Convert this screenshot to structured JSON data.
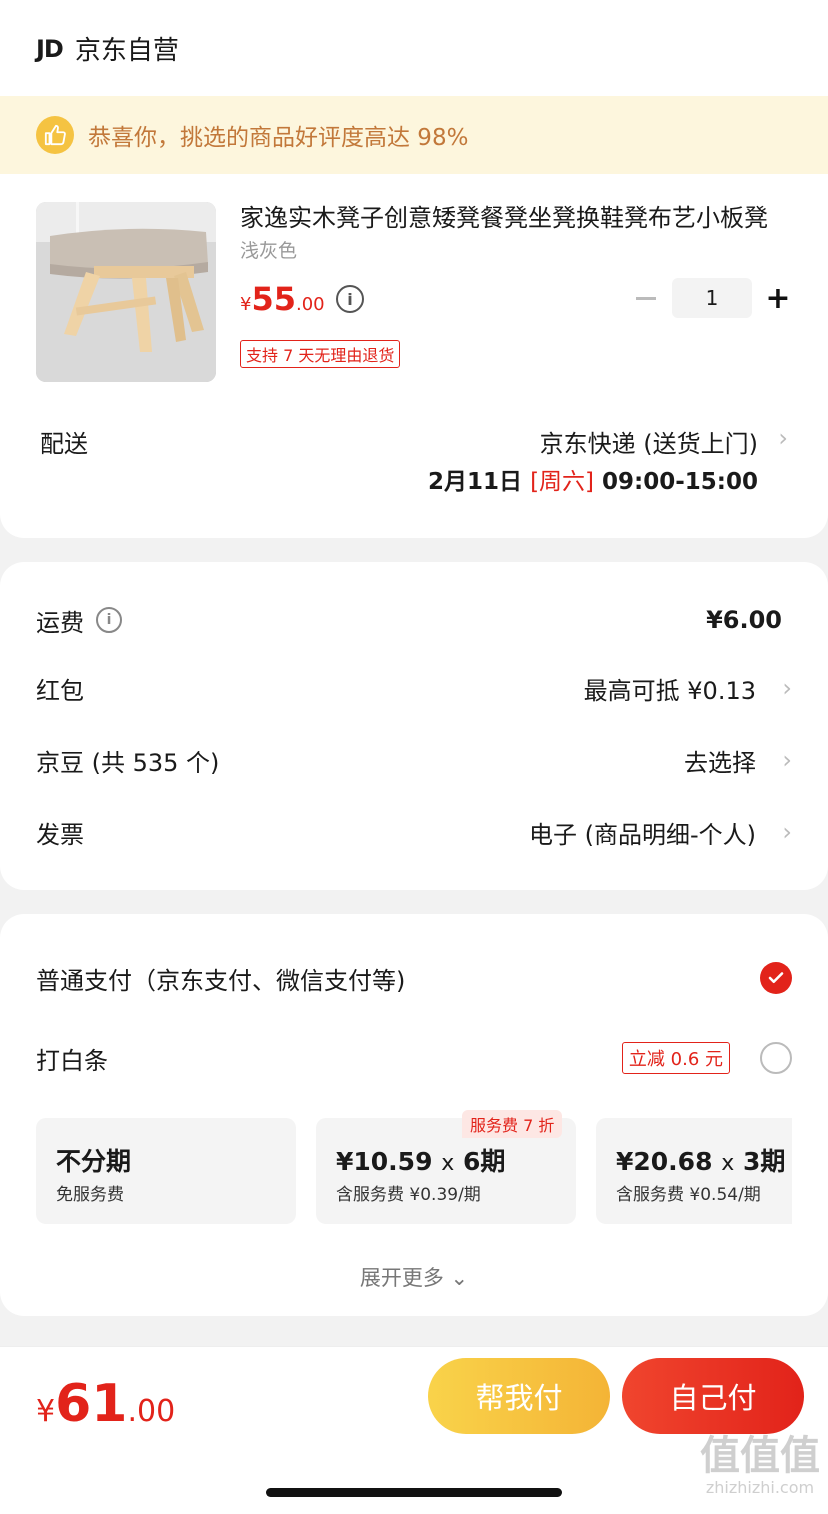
{
  "store": {
    "logo": "JD",
    "name": "京东自营"
  },
  "banner": {
    "text": "恭喜你，挑选的商品好评度高达 98%"
  },
  "product": {
    "title": "家逸实木凳子创意矮凳餐凳坐凳换鞋凳布艺小板凳",
    "variant": "浅灰色",
    "price_symbol": "¥",
    "price_int": "55",
    "price_dec": ".00",
    "return_policy": "支持 7 天无理由退货",
    "quantity": "1",
    "plus": "+"
  },
  "delivery": {
    "label": "配送",
    "method": "京东快递 (送货上门)",
    "date": "2月11日 ",
    "weekday": "[周六]",
    "time": " 09:00-15:00"
  },
  "fees": {
    "shipping_label": "运费",
    "shipping_value": "¥6.00",
    "redpacket_label": "红包",
    "redpacket_value": "最高可抵 ¥0.13",
    "beans_label": "京豆 (共 535 个)",
    "beans_value": "去选择",
    "invoice_label": "发票",
    "invoice_value": "电子 (商品明细-个人)"
  },
  "payment": {
    "normal_label": "普通支付（京东支付、微信支付等)",
    "baitiao_label": "打白条",
    "baitiao_discount": "立减 0.6 元",
    "service_badge": "服务费 7 折",
    "installments": [
      {
        "main": "不分期",
        "sub": "免服务费"
      },
      {
        "amount": "¥10.59",
        "x": "x",
        "period": "6期",
        "sub": "含服务费 ¥0.39/期"
      },
      {
        "amount": "¥20.68",
        "x": "x",
        "period": "3期",
        "sub": "含服务费 ¥0.54/期"
      }
    ],
    "expand": "展开更多"
  },
  "footer": {
    "total_symbol": "¥",
    "total_int": "61",
    "total_dec": ".00",
    "helper_button": "帮我付",
    "self_button": "自己付"
  },
  "watermark": {
    "text": "值值值",
    "url": "zhizhizhi.com"
  },
  "colors": {
    "accent": "#e2231a",
    "banner_bg": "#fdf6dd",
    "banner_text": "#c2783a",
    "helper_btn": "#f5c040"
  }
}
